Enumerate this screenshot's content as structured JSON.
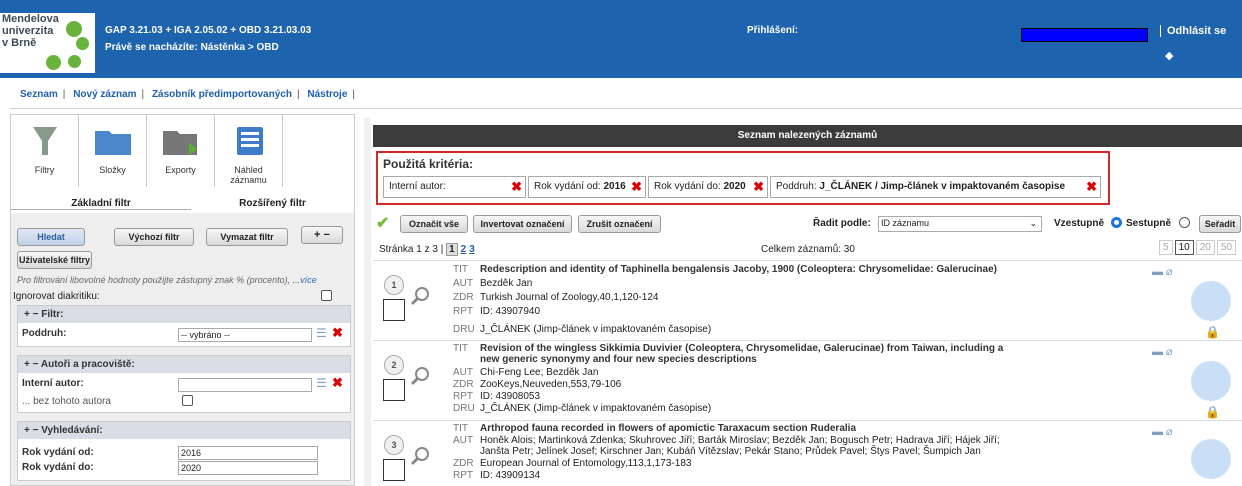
{
  "header": {
    "logo_lines": [
      "Mendelova",
      "univerzita",
      "v Brně"
    ],
    "version": "GAP 3.21.03 + IGA 2.05.02 + OBD 3.21.03.03",
    "location": "Právě se nacházíte: Nástěnka >  OBD",
    "login": "Přihlášení:",
    "logout": "Odhlásit se",
    "progress": 1.0,
    "accent": "#1e63ad"
  },
  "menu": {
    "items": [
      "Seznam",
      "Nový záznam",
      "Zásobník předimportovaných",
      "Nástroje"
    ]
  },
  "left": {
    "toolbar": [
      {
        "label": "Filtry",
        "icon": "funnel-icon"
      },
      {
        "label": "Složky",
        "icon": "folder-icon"
      },
      {
        "label": "Exporty",
        "icon": "export-folder-icon"
      },
      {
        "label": "Náhled záznamu",
        "icon": "record-preview-icon"
      }
    ],
    "tabs": [
      "Základní filtr",
      "Rozšířený filtr"
    ],
    "buttons": {
      "search": "Hledat",
      "default_filter": "Výchozí filtr",
      "clear_filter": "Vymazat filtr",
      "plusminus": "+ −",
      "user_filters": "Uživatelské filtry"
    },
    "hint": "Pro filtrování libovolné hodnoty použijte zástupný znak % (procento), ...",
    "hint_more": "více",
    "ignore_diacritics": "Ignorovat diakritiku:",
    "sections": {
      "filter": {
        "title": "+  −   Filtr:",
        "subtype_label": "Poddruh:",
        "subtype_value": "-- vybráno --"
      },
      "authors": {
        "title": "+  −   Autoři a pracoviště:",
        "author_label": "Interní autor:",
        "author_value": "",
        "without_label": "... bez tohoto autora"
      },
      "search": {
        "title": "+  −   Vyhledávání:",
        "year_from_label": "Rok vydání od:",
        "year_from": "2016",
        "year_to_label": "Rok vydání do:",
        "year_to": "2020"
      }
    }
  },
  "right": {
    "title": "Seznam nalezených záznamů",
    "criteria_title": "Použitá kritéria:",
    "criteria": [
      {
        "label": "Interní autor:",
        "value": ""
      },
      {
        "label": "Rok vydání od:",
        "value": "2016"
      },
      {
        "label": "Rok vydání do:",
        "value": "2020"
      },
      {
        "label": "Poddruh:",
        "value": "J_ČLÁNEK / Jimp-článek v impaktovaném časopise"
      }
    ],
    "toolbar": {
      "select_all": "Označit vše",
      "invert": "Invertovat označení",
      "clear": "Zrušit označení",
      "sort_label": "Řadit podle:",
      "sort_value": "ID záznamu",
      "asc": "Vzestupně",
      "desc": "Sestupně",
      "sort_btn": "Seřadit"
    },
    "pager": {
      "text": "Stránka 1 z 3 |",
      "current": "1",
      "pages": [
        "2",
        "3"
      ],
      "total": "Celkem záznamů: 30",
      "per_page": [
        "5",
        "10",
        "20",
        "50"
      ],
      "per_page_selected": "10"
    },
    "records": [
      {
        "num": "1",
        "TIT": "Redescription and identity of Taphinella bengalensis Jacoby, 1900 (Coleoptera: Chrysomelidae: Galerucinae)",
        "AUT": "Bezděk Jan",
        "ZDR": "Turkish Journal of Zoology,40,1,120-124",
        "RPT": "ID: 43907940",
        "DRU": "J_ČLÁNEK  (Jimp-článek v impaktovaném časopise)"
      },
      {
        "num": "2",
        "TIT": "Revision of the wingless Sikkimia Duvivier (Coleoptera, Chrysomelidae, Galerucinae) from Taiwan, including a",
        "TIT2": "new generic synonymy and four new species descriptions",
        "AUT": "Chi-Feng Lee; Bezděk Jan",
        "ZDR": "ZooKeys,Neuveden,553,79-106",
        "RPT": "ID: 43908053",
        "DRU": "J_ČLÁNEK  (Jimp-článek v impaktovaném časopise)"
      },
      {
        "num": "3",
        "TIT": "Arthropod fauna recorded in flowers of apomictic Taraxacum section Ruderalia",
        "AUT": "Honěk Alois; Martinková Zdenka; Skuhrovec Jiří; Barták Miroslav; Bezděk Jan; Bogusch Petr; Hadrava Jiří; Hájek Jiří;",
        "AUT2": "Janšta Petr; Jelínek Josef; Kirschner Jan; Kubáň Vítězslav; Pekár Stano; Průdek Pavel; Štys Pavel; Šumpich Jan",
        "ZDR": "European Journal of Entomology,113,1,173-183",
        "RPT": "ID: 43909134"
      }
    ],
    "labels": {
      "TIT": "TIT",
      "AUT": "AUT",
      "ZDR": "ZDR",
      "RPT": "RPT",
      "DRU": "DRU"
    }
  }
}
